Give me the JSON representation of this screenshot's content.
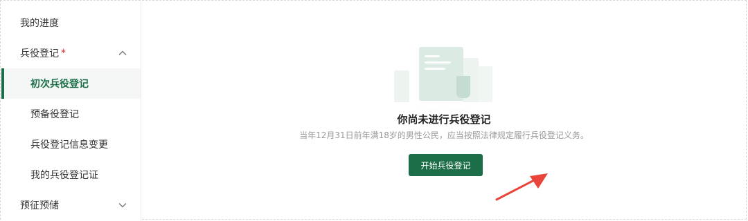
{
  "sidebar": {
    "items": [
      {
        "label": "我的进度"
      },
      {
        "label": "兵役登记",
        "required_mark": "*",
        "expanded": true,
        "icon": "chevron-up-icon"
      },
      {
        "label": "初次兵役登记",
        "active": true
      },
      {
        "label": "预备役登记"
      },
      {
        "label": "兵役登记信息变更"
      },
      {
        "label": "我的兵役登记证"
      },
      {
        "label": "预征预储",
        "expanded": false,
        "icon": "chevron-down-icon"
      }
    ]
  },
  "main": {
    "empty_title": "你尚未进行兵役登记",
    "empty_description": "当年12月31日前年满18岁的男性公民，应当按照法律规定履行兵役登记义务。",
    "start_button_label": "开始兵役登记",
    "illustration_icon": "document-illustration",
    "annotation_icon": "red-arrow-icon"
  },
  "colors": {
    "primary": "#1b6e47",
    "active_background": "#f4f7f5",
    "required_star": "#e0292d",
    "annotation_arrow": "#e8443a",
    "description_text": "#9a9a9a"
  }
}
